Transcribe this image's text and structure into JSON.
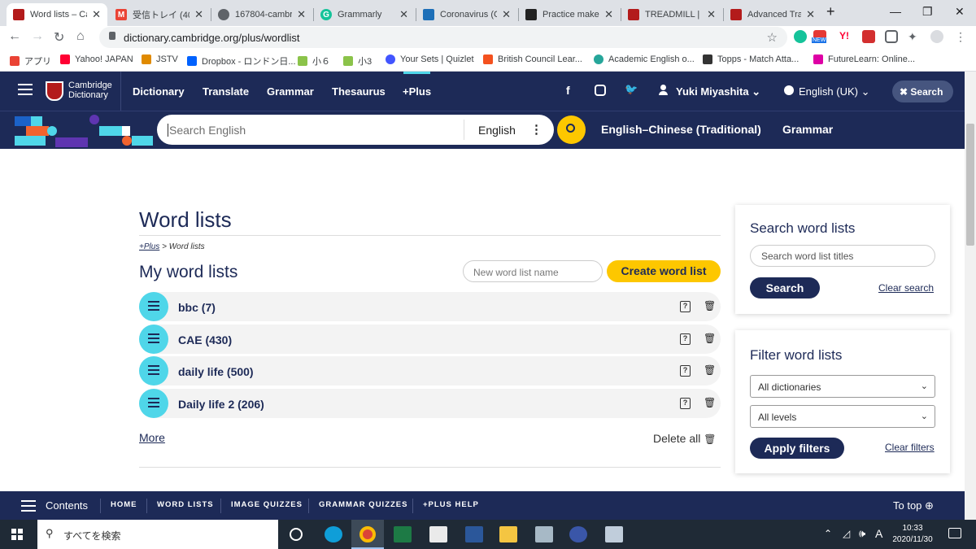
{
  "browser": {
    "tabs": [
      {
        "title": "Word lists – Ca",
        "active": true,
        "fav": "#b31b1b"
      },
      {
        "title": "受信トレイ (401",
        "active": false,
        "fav": "#ea4335"
      },
      {
        "title": "167804-cambr",
        "active": false,
        "fav": "#5f6368"
      },
      {
        "title": "Grammarly",
        "active": false,
        "fav": "#15c39a"
      },
      {
        "title": "Coronavirus (C",
        "active": false,
        "fav": "#1d6fb8"
      },
      {
        "title": "Practice make",
        "active": false,
        "fav": "#222222"
      },
      {
        "title": "TREADMILL | m",
        "active": false,
        "fav": "#b31b1b"
      },
      {
        "title": "Advanced Trai",
        "active": false,
        "fav": "#b31b1b"
      }
    ],
    "url": "dictionary.cambridge.org/plus/wordlist",
    "new_badge": "NEW",
    "bookmarks": [
      {
        "label": "アプリ",
        "color": "#ea4335"
      },
      {
        "label": "Yahoo! JAPAN",
        "color": "#ff0033"
      },
      {
        "label": "JSTV",
        "color": "#e08a00"
      },
      {
        "label": "Dropbox - ロンドン日...",
        "color": "#0061fe"
      },
      {
        "label": "小６",
        "color": "#8bc34a"
      },
      {
        "label": "小3",
        "color": "#8bc34a"
      },
      {
        "label": "Your Sets | Quizlet",
        "color": "#4255ff"
      },
      {
        "label": "British Council Lear...",
        "color": "#f4511e"
      },
      {
        "label": "Academic English o...",
        "color": "#26a69a"
      },
      {
        "label": "Topps - Match Atta...",
        "color": "#333333"
      },
      {
        "label": "FutureLearn: Online...",
        "color": "#de00a5"
      }
    ]
  },
  "site": {
    "logo_line1": "Cambridge",
    "logo_line2": "Dictionary",
    "nav": [
      "Dictionary",
      "Translate",
      "Grammar",
      "Thesaurus",
      "+Plus"
    ],
    "user": "Yuki Miyashita",
    "language": "English (UK)",
    "search_button": "Search",
    "search_placeholder": "Search English",
    "search_dict": "English",
    "sub_links": [
      "English–Chinese (Traditional)",
      "Grammar"
    ]
  },
  "main": {
    "title": "Word lists",
    "breadcrumb_plus": "+Plus",
    "breadcrumb_sep": " > ",
    "breadcrumb_current": "Word lists",
    "my_lists_heading": "My word lists",
    "new_list_placeholder": "New word list name",
    "create_button": "Create word list",
    "lists": [
      {
        "name": "bbc (7)"
      },
      {
        "name": "CAE (430)"
      },
      {
        "name": "daily life (500)"
      },
      {
        "name": "Daily life 2 (206)"
      }
    ],
    "more_link": "More",
    "delete_all": "Delete all"
  },
  "sidebar": {
    "search_heading": "Search word lists",
    "search_placeholder": "Search word list titles",
    "search_button": "Search",
    "clear_search": "Clear search",
    "filter_heading": "Filter word lists",
    "dict_select": "All dictionaries",
    "level_select": "All levels",
    "apply_button": "Apply filters",
    "clear_filters": "Clear filters"
  },
  "bottom_nav": {
    "contents": "Contents",
    "links": [
      "HOME",
      "WORD LISTS",
      "IMAGE QUIZZES",
      "GRAMMAR QUIZZES",
      "+PLUS HELP"
    ],
    "to_top": "To top"
  },
  "taskbar": {
    "search_placeholder": "すべてを検索",
    "time": "10:33",
    "date": "2020/11/30",
    "ime": "A"
  },
  "colors": {
    "navy": "#1d2a57",
    "accent_yellow": "#fdc700",
    "cyan": "#4fd6e9"
  }
}
